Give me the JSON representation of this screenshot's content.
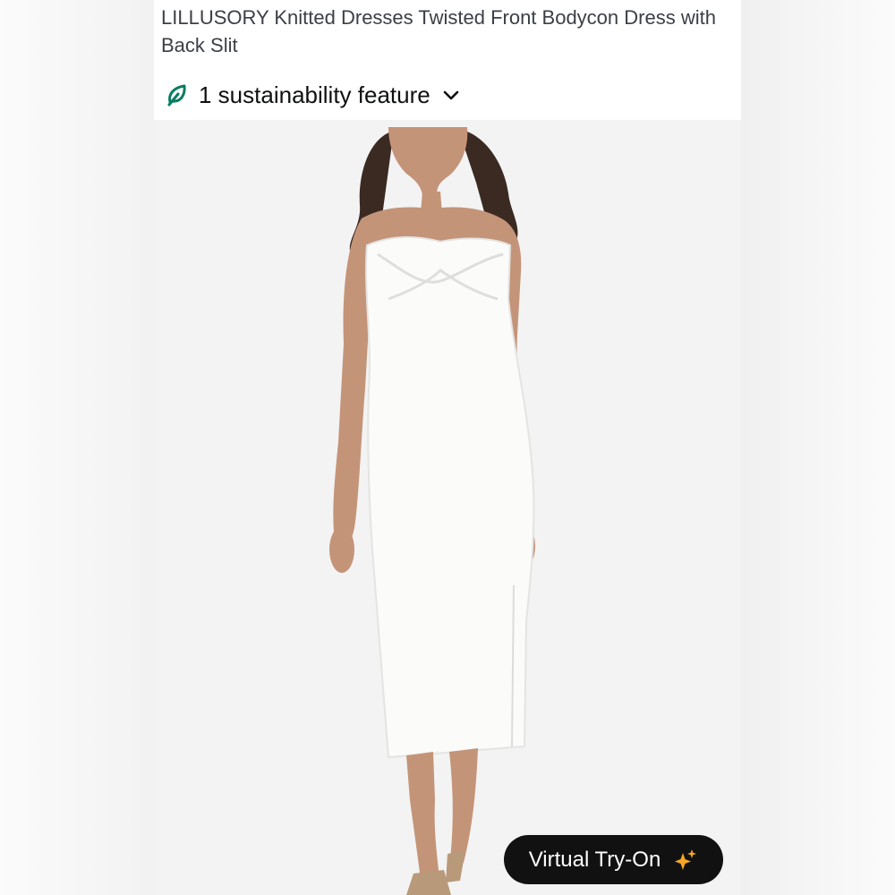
{
  "product": {
    "title": "LILLUSORY Knitted Dresses Twisted Front Bodycon Dress with Back Slit"
  },
  "sustainability": {
    "label": "1 sustainability feature",
    "icon": "leaf-icon",
    "expand_icon": "chevron-down-icon",
    "accent_color": "#067D62"
  },
  "image": {
    "description_icon": "product-photo"
  },
  "virtual_try_on": {
    "label": "Virtual Try-On",
    "icon": "sparkle-icon",
    "sparkle_color": "#F5A623"
  }
}
